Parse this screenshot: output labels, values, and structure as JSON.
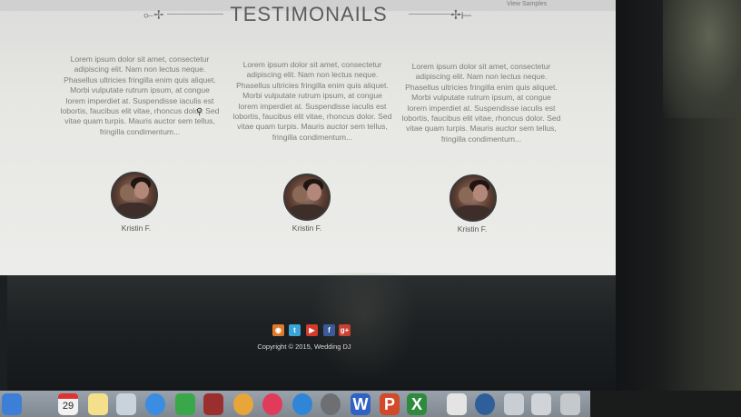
{
  "browser": {
    "tab_text_1": "",
    "tab_text_2": "View Samples"
  },
  "section": {
    "title": "TESTIMONAILS"
  },
  "testimonials": [
    {
      "text": "Lorem ipsum dolor sit amet, consectetur adipiscing elit. Nam non lectus neque. Phasellus ultricies fringilla enim quis aliquet. Morbi vulputate rutrum ipsum, at congue lorem imperdiet at. Suspendisse iaculis est lobortis, faucibus elit vitae, rhoncus dolor. Sed vitae quam turpis. Mauris auctor sem tellus, fringilla condimentum...",
      "name": "Kristin F."
    },
    {
      "text": "Lorem ipsum dolor sit amet, consectetur adipiscing elit. Nam non lectus neque. Phasellus ultricies fringilla enim quis aliquet. Morbi vulputate rutrum ipsum, at congue lorem imperdiet at. Suspendisse iaculis est lobortis, faucibus elit vitae, rhoncus dolor. Sed vitae quam turpis. Mauris auctor sem tellus, fringilla condimentum...",
      "name": "Kristin F."
    },
    {
      "text": "Lorem ipsum dolor sit amet, consectetur adipiscing elit. Nam non lectus neque. Phasellus ultricies fringilla enim quis aliquet. Morbi vulputate rutrum ipsum, at congue lorem imperdiet at. Suspendisse iaculis est lobortis, faucibus elit vitae, rhoncus dolor. Sed vitae quam turpis. Mauris auctor sem tellus, fringilla condimentum...",
      "name": "Kristin F."
    }
  ],
  "footer": {
    "copyright": "Copyright © 2015, Wedding DJ",
    "social": [
      {
        "icon": "rss-icon",
        "glyph": "◉",
        "color": "#e07a2a"
      },
      {
        "icon": "twitter-icon",
        "glyph": "t",
        "color": "#3aa3d8"
      },
      {
        "icon": "youtube-icon",
        "glyph": "▶",
        "color": "#d23a2a"
      },
      {
        "icon": "facebook-icon",
        "glyph": "f",
        "color": "#3b5a9a"
      },
      {
        "icon": "google-plus-icon",
        "glyph": "g+",
        "color": "#c8402f"
      }
    ]
  },
  "dock": {
    "calendar_day": "29",
    "apps": [
      {
        "icon": "finder-icon",
        "color": "#3d7fd6"
      },
      {
        "icon": "calendar-icon",
        "color": "#f2f2f2"
      },
      {
        "icon": "notes-icon",
        "color": "#f4e08a"
      },
      {
        "icon": "preview-icon",
        "color": "#c9d3dc"
      },
      {
        "icon": "messages-icon",
        "color": "#3a8de0"
      },
      {
        "icon": "facetime-icon",
        "color": "#3aa84a"
      },
      {
        "icon": "photo-booth-icon",
        "color": "#9b2f2f"
      },
      {
        "icon": "photos-icon",
        "color": "#e7a53a"
      },
      {
        "icon": "itunes-icon",
        "color": "#e23a5a"
      },
      {
        "icon": "app-store-icon",
        "color": "#2f86d6"
      },
      {
        "icon": "system-preferences-icon",
        "color": "#6d6f73"
      },
      {
        "icon": "word-icon",
        "color": "#2f62c4"
      },
      {
        "icon": "powerpoint-icon",
        "color": "#d24a2a"
      },
      {
        "icon": "excel-icon",
        "color": "#2e8b3e"
      },
      {
        "icon": "document-icon",
        "color": "#e4e4e4"
      },
      {
        "icon": "quicktime-icon",
        "color": "#2f5f9a"
      },
      {
        "icon": "window-icon",
        "color": "#c9ced4"
      },
      {
        "icon": "screen-icon",
        "color": "#d0d4d8"
      },
      {
        "icon": "trash-icon",
        "color": "#c5c9cc"
      }
    ]
  }
}
